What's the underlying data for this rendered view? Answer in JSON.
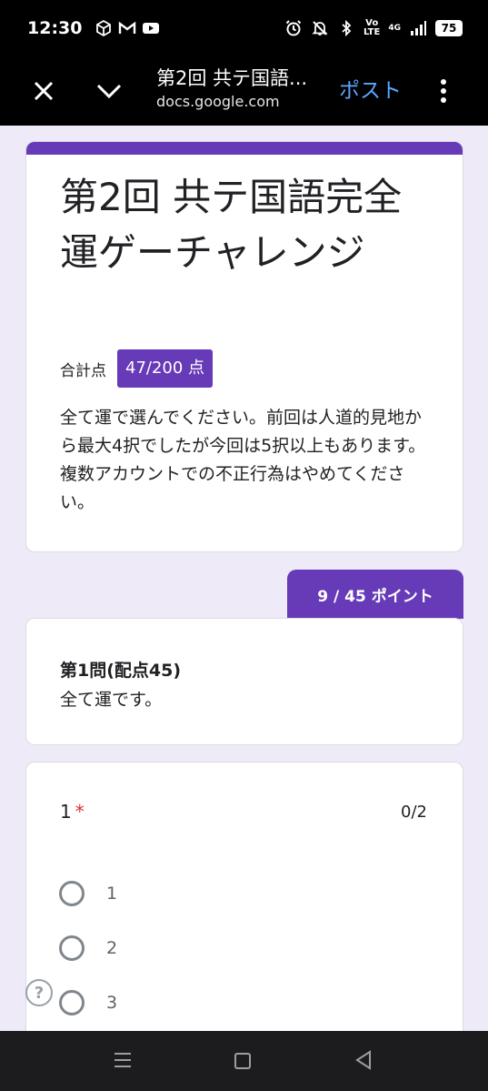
{
  "status_bar": {
    "time": "12:30",
    "volte": "Vo\nLTE",
    "network": "4G",
    "battery": "75"
  },
  "app_bar": {
    "title": "第2回 共テ国語...",
    "url": "docs.google.com",
    "post_label": "ポスト"
  },
  "form": {
    "title": "第2回 共テ国語完全運ゲーチャレンジ",
    "score_label": "合計点",
    "score_value": "47/200 点",
    "description": "全て運で選んでください。前回は人道的見地から最大4択でしたが今回は5択以上もあります。複数アカウントでの不正行為はやめてください。"
  },
  "section": {
    "points": "9 / 45 ポイント",
    "title": "第1問(配点45)",
    "description": "全て運です。"
  },
  "question": {
    "number": "1",
    "required_mark": "*",
    "score": "0/2",
    "options": [
      "1",
      "2",
      "3"
    ]
  },
  "colors": {
    "accent": "#673ab7",
    "background": "#efeaf8",
    "link_blue": "#5aa6ff",
    "required_red": "#d93025"
  }
}
